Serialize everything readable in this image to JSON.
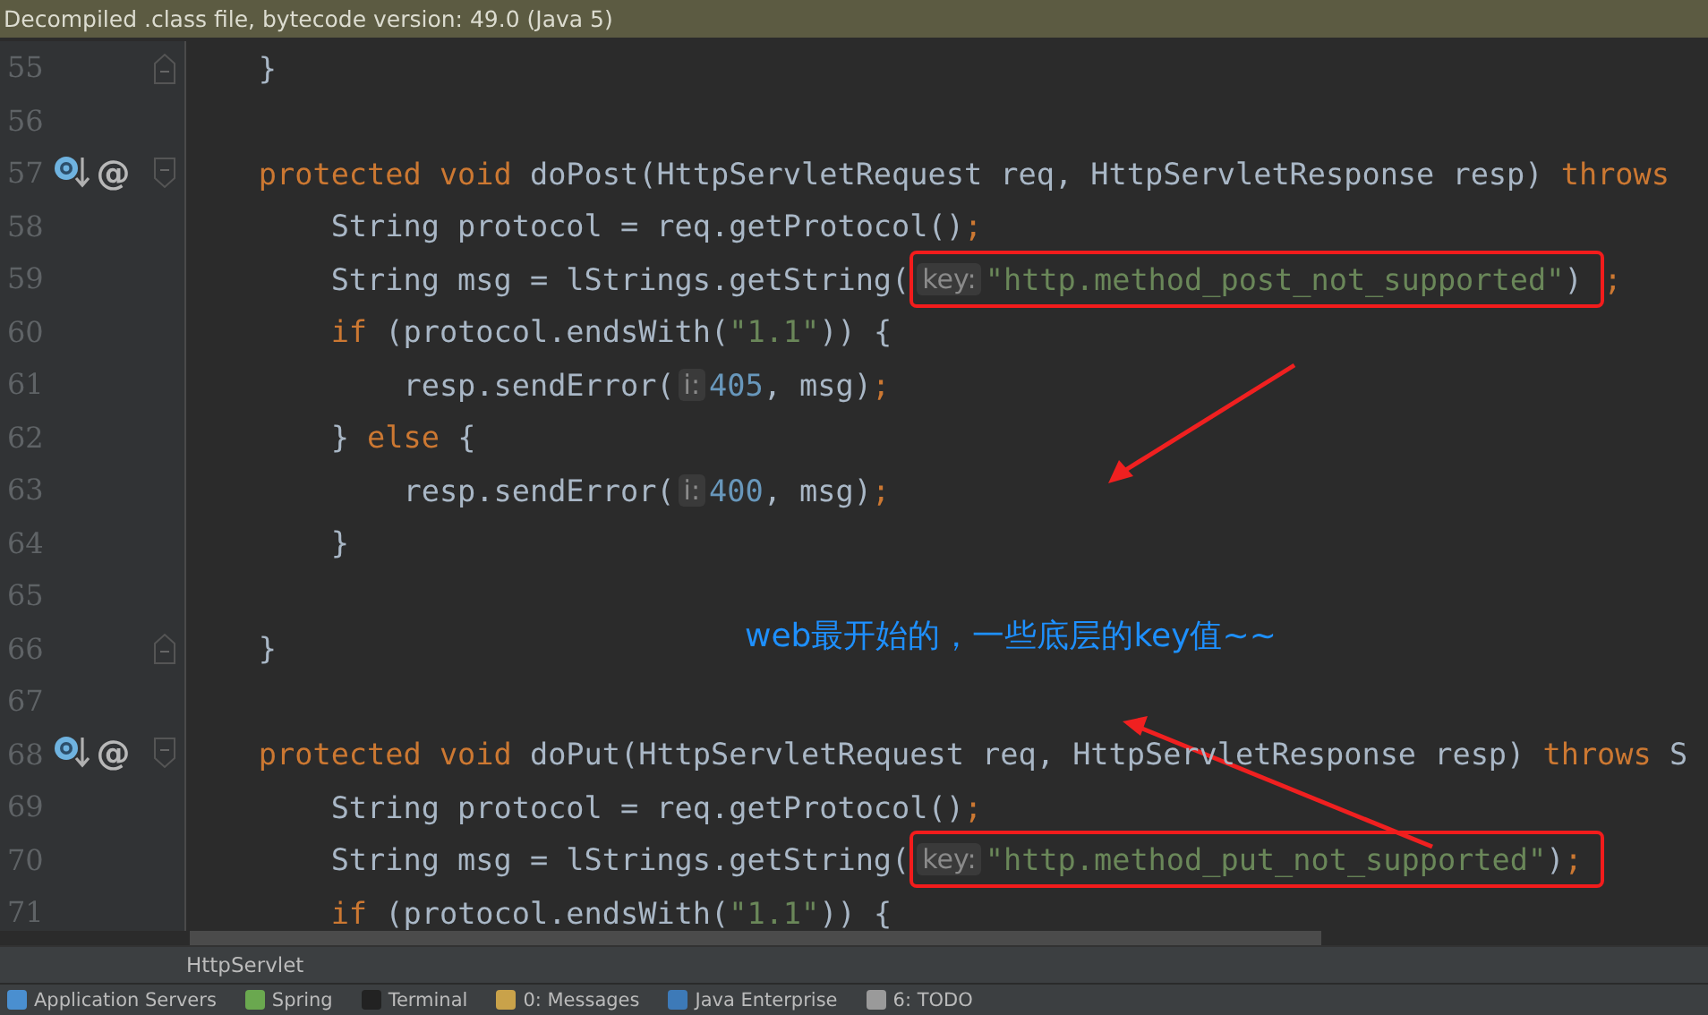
{
  "banner": {
    "text": "Decompiled .class file, bytecode version: 49.0 (Java 5)"
  },
  "editor": {
    "lines": [
      {
        "number": "55",
        "fold_end": true,
        "tokens": [
          {
            "kind": "plain",
            "text": "    }"
          }
        ]
      },
      {
        "number": "56"
      },
      {
        "number": "57",
        "fold_start": true,
        "override": true,
        "mark": "@",
        "tokens": [
          {
            "kind": "keyword",
            "text": "    protected void "
          },
          {
            "kind": "plain",
            "text": "doPost(HttpServletRequest req, HttpServletResponse resp) "
          },
          {
            "kind": "keyword",
            "text": "throws"
          }
        ]
      },
      {
        "number": "58",
        "tokens": [
          {
            "kind": "plain",
            "text": "        String protocol = req.getProtocol()"
          },
          {
            "kind": "punct",
            "text": ";"
          }
        ]
      },
      {
        "number": "59",
        "tokens": [
          {
            "kind": "plain",
            "text": "        String msg = lStrings.getString("
          },
          {
            "kind": "hint",
            "text": "key:",
            "boxed": true
          },
          {
            "kind": "string",
            "text": "\"http.method_post_not_supported\"",
            "boxed": true
          },
          {
            "kind": "plain",
            "text": ")",
            "boxed": true
          },
          {
            "kind": "punct",
            "text": ";"
          }
        ]
      },
      {
        "number": "60",
        "tokens": [
          {
            "kind": "keyword",
            "text": "        if"
          },
          {
            "kind": "plain",
            "text": " (protocol.endsWith("
          },
          {
            "kind": "string",
            "text": "\"1.1\""
          },
          {
            "kind": "plain",
            "text": ")) {"
          }
        ]
      },
      {
        "number": "61",
        "tokens": [
          {
            "kind": "plain",
            "text": "            resp.sendError("
          },
          {
            "kind": "hint",
            "text": "i:"
          },
          {
            "kind": "number",
            "text": "405"
          },
          {
            "kind": "plain",
            "text": ", msg)"
          },
          {
            "kind": "punct",
            "text": ";"
          }
        ]
      },
      {
        "number": "62",
        "tokens": [
          {
            "kind": "plain",
            "text": "        } "
          },
          {
            "kind": "keyword",
            "text": "else"
          },
          {
            "kind": "plain",
            "text": " {"
          }
        ]
      },
      {
        "number": "63",
        "tokens": [
          {
            "kind": "plain",
            "text": "            resp.sendError("
          },
          {
            "kind": "hint",
            "text": "i:"
          },
          {
            "kind": "number",
            "text": "400"
          },
          {
            "kind": "plain",
            "text": ", msg)"
          },
          {
            "kind": "punct",
            "text": ";"
          }
        ]
      },
      {
        "number": "64",
        "tokens": [
          {
            "kind": "plain",
            "text": "        }"
          }
        ]
      },
      {
        "number": "65"
      },
      {
        "number": "66",
        "fold_end": true,
        "tokens": [
          {
            "kind": "plain",
            "text": "    }"
          }
        ]
      },
      {
        "number": "67"
      },
      {
        "number": "68",
        "fold_start": true,
        "override": true,
        "mark": "@",
        "tokens": [
          {
            "kind": "keyword",
            "text": "    protected void "
          },
          {
            "kind": "plain",
            "text": "doPut(HttpServletRequest req, HttpServletResponse resp) "
          },
          {
            "kind": "keyword",
            "text": "throws"
          },
          {
            "kind": "plain",
            "text": " S"
          }
        ]
      },
      {
        "number": "69",
        "tokens": [
          {
            "kind": "plain",
            "text": "        String protocol = req.getProtocol()"
          },
          {
            "kind": "punct",
            "text": ";"
          }
        ]
      },
      {
        "number": "70",
        "tokens": [
          {
            "kind": "plain",
            "text": "        String msg = lStrings.getString("
          },
          {
            "kind": "hint",
            "text": "key:",
            "boxed": true
          },
          {
            "kind": "string",
            "text": "\"http.method_put_not_supported\"",
            "boxed": true
          },
          {
            "kind": "plain",
            "text": ")",
            "boxed": true
          },
          {
            "kind": "punct",
            "text": ";",
            "boxed": true
          }
        ]
      },
      {
        "number": "71",
        "tokens": [
          {
            "kind": "keyword",
            "text": "        if"
          },
          {
            "kind": "plain",
            "text": " (protocol.endsWith("
          },
          {
            "kind": "string",
            "text": "\"1.1\""
          },
          {
            "kind": "plain",
            "text": ")) {"
          }
        ]
      }
    ]
  },
  "annotation": {
    "text": "web最开始的，一些底层的key值~~"
  },
  "breadcrumb": {
    "text": "HttpServlet"
  },
  "tool_windows": [
    {
      "label": "Application Servers",
      "color": "#4a8fd0"
    },
    {
      "label": "Spring",
      "color": "#6aa84f"
    },
    {
      "label": "Terminal",
      "color": "#222222"
    },
    {
      "label": "0: Messages",
      "color": "#c9a24a"
    },
    {
      "label": "Java Enterprise",
      "color": "#3d7ab8"
    },
    {
      "label": "6: TODO",
      "color": "#9a9a9a"
    }
  ]
}
